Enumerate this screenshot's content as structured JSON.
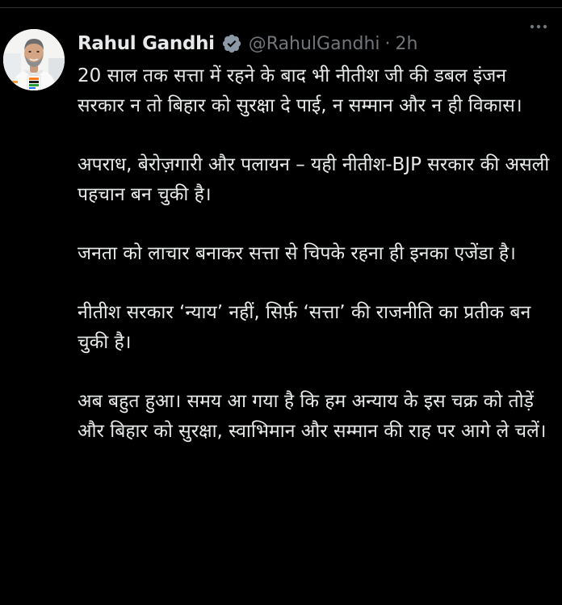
{
  "tweet": {
    "author": {
      "display_name": "Rahul Gandhi",
      "handle": "@RahulGandhi",
      "verified": true
    },
    "separator": "·",
    "timestamp": "2h",
    "more_icon": "more-horizontal-icon",
    "paragraphs": [
      "20 साल तक सत्ता में रहने के बाद भी नीतीश जी की डबल इंजन सरकार न तो बिहार को सुरक्षा दे पाई, न सम्मान और न ही विकास।",
      "अपराध, बेरोज़गारी और पलायन – यही नीतीश-BJP सरकार की असली पहचान बन चुकी है।",
      "जनता को लाचार बनाकर सत्ता से चिपके रहना ही इनका एजेंडा है।",
      "नीतीश सरकार ‘न्याय’ नहीं, सिर्फ़ ‘सत्ता’ की राजनीति का प्रतीक बन चुकी है।",
      "अब बहुत हुआ। समय आ गया है कि हम अन्याय के इस चक्र को तोड़ें और बिहार को सुरक्षा, स्वाभिमान और सम्मान की राह पर आगे ले चलें।"
    ]
  },
  "colors": {
    "background": "#000000",
    "text_primary": "#e7e9ea",
    "text_secondary": "#71767b",
    "verified_badge": "#8b98a5",
    "divider": "#2f3336"
  }
}
